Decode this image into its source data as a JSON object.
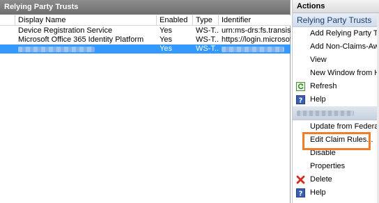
{
  "left": {
    "title": "Relying Party Trusts",
    "columns": [
      "Display Name",
      "Enabled",
      "Type",
      "Identifier"
    ],
    "rows": [
      {
        "name": "Device Registration Service",
        "enabled": "Yes",
        "type": "WS-T...",
        "identifier": "urn:ms-drs:fs.transishun.co"
      },
      {
        "name": "Microsoft Office 365 Identity Platform",
        "enabled": "Yes",
        "type": "WS-T...",
        "identifier": "https://login.microsoftonlin"
      },
      {
        "name": "",
        "enabled": "Yes",
        "type": "WS-T...",
        "identifier": "",
        "selected": true,
        "redacted": true
      }
    ]
  },
  "actions": {
    "title": "Actions",
    "section1": "Relying Party Trusts",
    "items1": [
      {
        "label": "Add Relying Party Trust...",
        "icon": "none"
      },
      {
        "label": "Add Non-Claims-Aware",
        "icon": "none"
      },
      {
        "label": "View",
        "icon": "none"
      },
      {
        "label": "New Window from Here",
        "icon": "none"
      },
      {
        "label": "Refresh",
        "icon": "refresh-icon"
      },
      {
        "label": "Help",
        "icon": "help-icon"
      }
    ],
    "section2": "",
    "items2": [
      {
        "label": "Update from Federation",
        "icon": "none"
      },
      {
        "label": "Edit Claim Rules...",
        "icon": "none"
      },
      {
        "label": "Disable",
        "icon": "none"
      },
      {
        "label": "Properties",
        "icon": "none"
      },
      {
        "label": "Delete",
        "icon": "delete-icon"
      },
      {
        "label": "Help",
        "icon": "help-icon"
      }
    ]
  },
  "colors": {
    "selection": "#3399ff",
    "highlight": "#f07d2a"
  }
}
